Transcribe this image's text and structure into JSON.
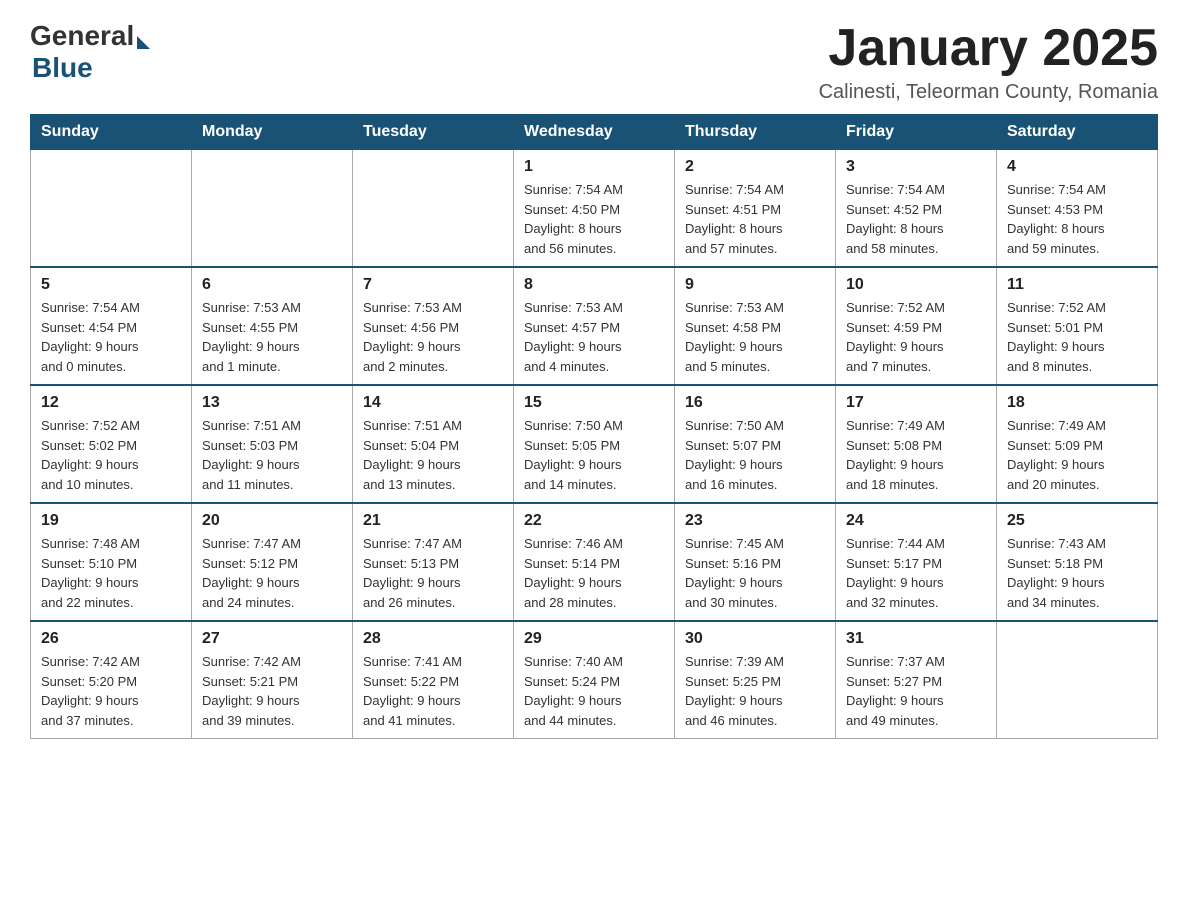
{
  "header": {
    "title": "January 2025",
    "location": "Calinesti, Teleorman County, Romania",
    "logo": {
      "general": "General",
      "blue": "Blue"
    }
  },
  "weekdays": [
    "Sunday",
    "Monday",
    "Tuesday",
    "Wednesday",
    "Thursday",
    "Friday",
    "Saturday"
  ],
  "weeks": [
    [
      {
        "day": "",
        "info": ""
      },
      {
        "day": "",
        "info": ""
      },
      {
        "day": "",
        "info": ""
      },
      {
        "day": "1",
        "info": "Sunrise: 7:54 AM\nSunset: 4:50 PM\nDaylight: 8 hours\nand 56 minutes."
      },
      {
        "day": "2",
        "info": "Sunrise: 7:54 AM\nSunset: 4:51 PM\nDaylight: 8 hours\nand 57 minutes."
      },
      {
        "day": "3",
        "info": "Sunrise: 7:54 AM\nSunset: 4:52 PM\nDaylight: 8 hours\nand 58 minutes."
      },
      {
        "day": "4",
        "info": "Sunrise: 7:54 AM\nSunset: 4:53 PM\nDaylight: 8 hours\nand 59 minutes."
      }
    ],
    [
      {
        "day": "5",
        "info": "Sunrise: 7:54 AM\nSunset: 4:54 PM\nDaylight: 9 hours\nand 0 minutes."
      },
      {
        "day": "6",
        "info": "Sunrise: 7:53 AM\nSunset: 4:55 PM\nDaylight: 9 hours\nand 1 minute."
      },
      {
        "day": "7",
        "info": "Sunrise: 7:53 AM\nSunset: 4:56 PM\nDaylight: 9 hours\nand 2 minutes."
      },
      {
        "day": "8",
        "info": "Sunrise: 7:53 AM\nSunset: 4:57 PM\nDaylight: 9 hours\nand 4 minutes."
      },
      {
        "day": "9",
        "info": "Sunrise: 7:53 AM\nSunset: 4:58 PM\nDaylight: 9 hours\nand 5 minutes."
      },
      {
        "day": "10",
        "info": "Sunrise: 7:52 AM\nSunset: 4:59 PM\nDaylight: 9 hours\nand 7 minutes."
      },
      {
        "day": "11",
        "info": "Sunrise: 7:52 AM\nSunset: 5:01 PM\nDaylight: 9 hours\nand 8 minutes."
      }
    ],
    [
      {
        "day": "12",
        "info": "Sunrise: 7:52 AM\nSunset: 5:02 PM\nDaylight: 9 hours\nand 10 minutes."
      },
      {
        "day": "13",
        "info": "Sunrise: 7:51 AM\nSunset: 5:03 PM\nDaylight: 9 hours\nand 11 minutes."
      },
      {
        "day": "14",
        "info": "Sunrise: 7:51 AM\nSunset: 5:04 PM\nDaylight: 9 hours\nand 13 minutes."
      },
      {
        "day": "15",
        "info": "Sunrise: 7:50 AM\nSunset: 5:05 PM\nDaylight: 9 hours\nand 14 minutes."
      },
      {
        "day": "16",
        "info": "Sunrise: 7:50 AM\nSunset: 5:07 PM\nDaylight: 9 hours\nand 16 minutes."
      },
      {
        "day": "17",
        "info": "Sunrise: 7:49 AM\nSunset: 5:08 PM\nDaylight: 9 hours\nand 18 minutes."
      },
      {
        "day": "18",
        "info": "Sunrise: 7:49 AM\nSunset: 5:09 PM\nDaylight: 9 hours\nand 20 minutes."
      }
    ],
    [
      {
        "day": "19",
        "info": "Sunrise: 7:48 AM\nSunset: 5:10 PM\nDaylight: 9 hours\nand 22 minutes."
      },
      {
        "day": "20",
        "info": "Sunrise: 7:47 AM\nSunset: 5:12 PM\nDaylight: 9 hours\nand 24 minutes."
      },
      {
        "day": "21",
        "info": "Sunrise: 7:47 AM\nSunset: 5:13 PM\nDaylight: 9 hours\nand 26 minutes."
      },
      {
        "day": "22",
        "info": "Sunrise: 7:46 AM\nSunset: 5:14 PM\nDaylight: 9 hours\nand 28 minutes."
      },
      {
        "day": "23",
        "info": "Sunrise: 7:45 AM\nSunset: 5:16 PM\nDaylight: 9 hours\nand 30 minutes."
      },
      {
        "day": "24",
        "info": "Sunrise: 7:44 AM\nSunset: 5:17 PM\nDaylight: 9 hours\nand 32 minutes."
      },
      {
        "day": "25",
        "info": "Sunrise: 7:43 AM\nSunset: 5:18 PM\nDaylight: 9 hours\nand 34 minutes."
      }
    ],
    [
      {
        "day": "26",
        "info": "Sunrise: 7:42 AM\nSunset: 5:20 PM\nDaylight: 9 hours\nand 37 minutes."
      },
      {
        "day": "27",
        "info": "Sunrise: 7:42 AM\nSunset: 5:21 PM\nDaylight: 9 hours\nand 39 minutes."
      },
      {
        "day": "28",
        "info": "Sunrise: 7:41 AM\nSunset: 5:22 PM\nDaylight: 9 hours\nand 41 minutes."
      },
      {
        "day": "29",
        "info": "Sunrise: 7:40 AM\nSunset: 5:24 PM\nDaylight: 9 hours\nand 44 minutes."
      },
      {
        "day": "30",
        "info": "Sunrise: 7:39 AM\nSunset: 5:25 PM\nDaylight: 9 hours\nand 46 minutes."
      },
      {
        "day": "31",
        "info": "Sunrise: 7:37 AM\nSunset: 5:27 PM\nDaylight: 9 hours\nand 49 minutes."
      },
      {
        "day": "",
        "info": ""
      }
    ]
  ]
}
